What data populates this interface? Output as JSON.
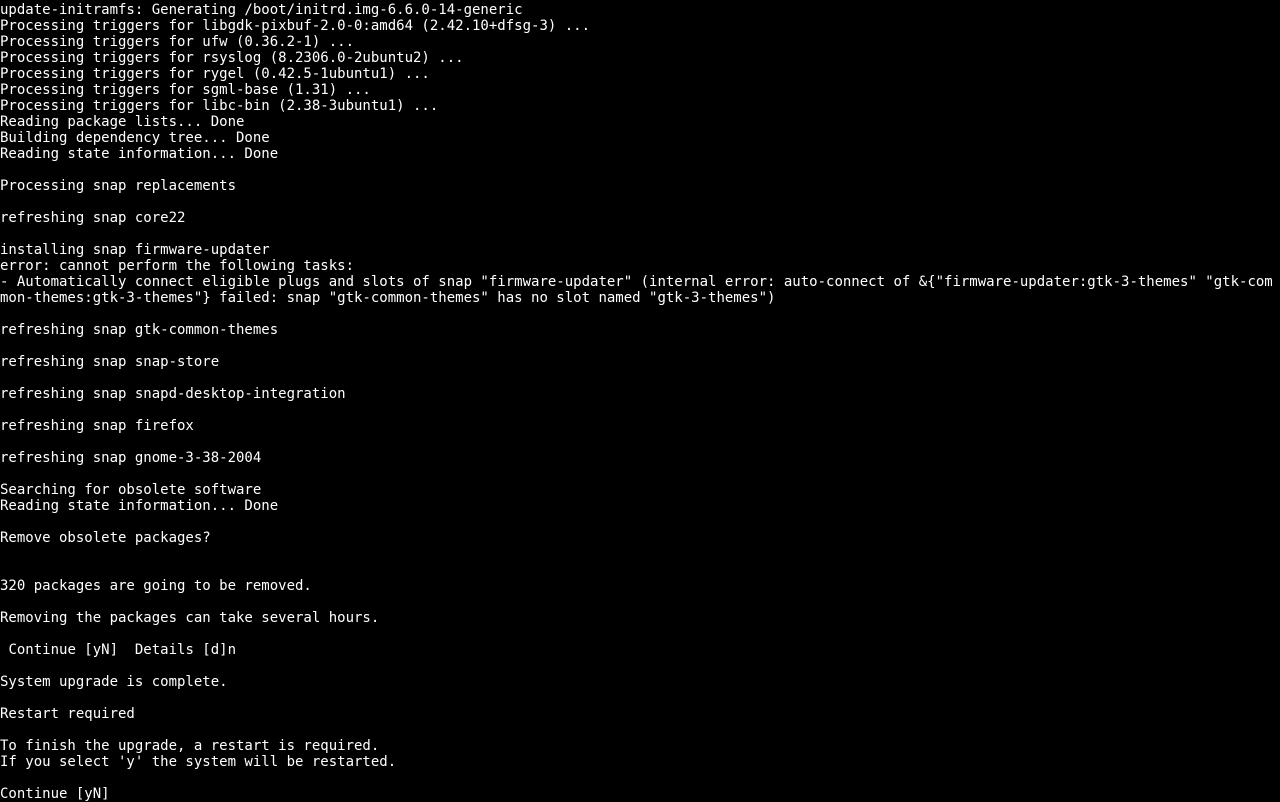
{
  "terminal": {
    "lines": [
      "update-initramfs: Generating /boot/initrd.img-6.6.0-14-generic",
      "Processing triggers for libgdk-pixbuf-2.0-0:amd64 (2.42.10+dfsg-3) ...",
      "Processing triggers for ufw (0.36.2-1) ...",
      "Processing triggers for rsyslog (8.2306.0-2ubuntu2) ...",
      "Processing triggers for rygel (0.42.5-1ubuntu1) ...",
      "Processing triggers for sgml-base (1.31) ...",
      "Processing triggers for libc-bin (2.38-3ubuntu1) ...",
      "Reading package lists... Done",
      "Building dependency tree... Done",
      "Reading state information... Done",
      "",
      "Processing snap replacements",
      "",
      "refreshing snap core22",
      "",
      "installing snap firmware-updater",
      "error: cannot perform the following tasks:",
      "- Automatically connect eligible plugs and slots of snap \"firmware-updater\" (internal error: auto-connect of &{\"firmware-updater:gtk-3-themes\" \"gtk-common-themes:gtk-3-themes\"} failed: snap \"gtk-common-themes\" has no slot named \"gtk-3-themes\")",
      "",
      "refreshing snap gtk-common-themes",
      "",
      "refreshing snap snap-store",
      "",
      "refreshing snap snapd-desktop-integration",
      "",
      "refreshing snap firefox",
      "",
      "refreshing snap gnome-3-38-2004",
      "",
      "Searching for obsolete software",
      "Reading state information... Done",
      "",
      "Remove obsolete packages?",
      "",
      "",
      "320 packages are going to be removed.",
      "",
      "Removing the packages can take several hours.",
      "",
      " Continue [yN]  Details [d]n",
      "",
      "System upgrade is complete.",
      "",
      "Restart required",
      "",
      "To finish the upgrade, a restart is required.",
      "If you select 'y' the system will be restarted.",
      "",
      "Continue [yN]"
    ]
  }
}
